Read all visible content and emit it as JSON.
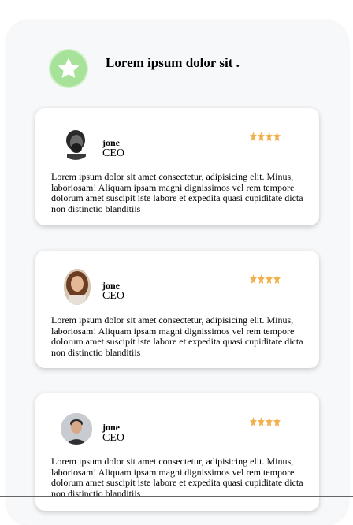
{
  "header": {
    "title": "Lorem ipsum dolor sit ."
  },
  "accent": {
    "badge_color": "#a6e29a",
    "star_color": "#f2b04c"
  },
  "testimonials": [
    {
      "name": "jone",
      "role": "CEO",
      "rating": 4,
      "avatar": "man-with-beard-photo",
      "text": "Lorem ipsum dolor sit amet consectetur, adipisicing elit. Minus, laboriosam! Aliquam ipsam magni dignissimos vel rem tempore dolorum amet suscipit iste labore et expedita quasi cupiditate dicta non distinctio blanditiis"
    },
    {
      "name": "jone",
      "role": "CEO",
      "rating": 4,
      "avatar": "woman-photo",
      "text": "Lorem ipsum dolor sit amet consectetur, adipisicing elit. Minus, laboriosam! Aliquam ipsam magni dignissimos vel rem tempore dolorum amet suscipit iste labore et expedita quasi cupiditate dicta non distinctio blanditiis"
    },
    {
      "name": "jone",
      "role": "CEO",
      "rating": 4,
      "avatar": "man-smiling-photo",
      "text": "Lorem ipsum dolor sit amet consectetur, adipisicing elit. Minus, laboriosam! Aliquam ipsam magni dignissimos vel rem tempore dolorum amet suscipit iste labore et expedita quasi cupiditate dicta non distinctio blanditiis"
    }
  ]
}
